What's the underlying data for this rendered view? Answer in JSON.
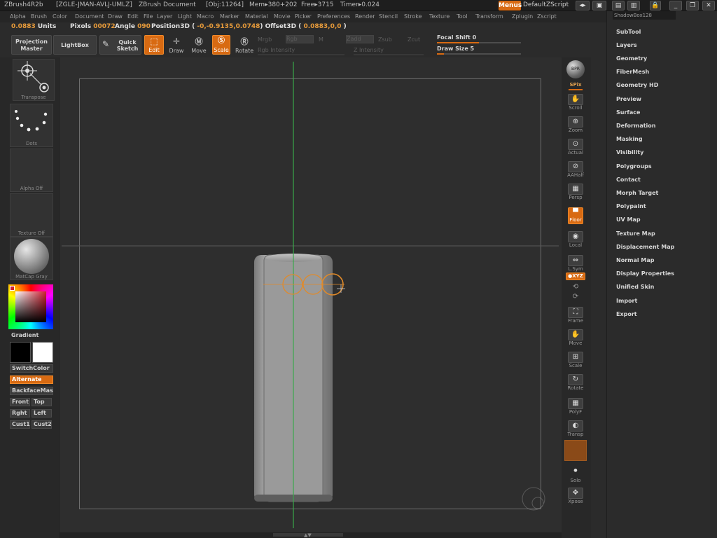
{
  "title": {
    "app": "ZBrush4R2b",
    "license": "[ZGLE-JMAN-AVLJ-UMLZ]",
    "document": "ZBrush Document",
    "obj": "[Obj:11264]",
    "mem": "Mem▸380+202",
    "free": "Free▸3715",
    "timer": "Timer▸0.024",
    "menus_button": "Menus",
    "script": "DefaultZScript",
    "shadowbox": "ShadowBox128"
  },
  "menu_items": [
    "Alpha",
    "Brush",
    "Color",
    "Document",
    "Draw",
    "Edit",
    "File",
    "Layer",
    "Light",
    "Macro",
    "Marker",
    "Material",
    "Movie",
    "Picker",
    "Preferences",
    "Render",
    "Stencil",
    "Stroke",
    "Texture",
    "Tool",
    "Transform",
    "Zplugin",
    "Zscript"
  ],
  "info": {
    "units_value": "0.0883",
    "units_label": "Units",
    "pixols_label": "Pixols",
    "pixols_value": "00072",
    "angle_label": "Angle",
    "angle_value": "090",
    "position_label": "Position3D (",
    "position_value": "-0,-0.9135,0.0748",
    "offset_label": ")  Offset3D (",
    "offset_value": "0.0883,0,0",
    "close_paren": ")"
  },
  "toolbar": {
    "projection_master": "Projection Master",
    "lightbox": "LightBox",
    "quick_sketch": "Quick Sketch",
    "edit": "Edit",
    "draw": "Draw",
    "move": "Move",
    "scale": "Scale",
    "rotate": "Rotate",
    "mrgb": "Mrgb",
    "rgb": "Rgb",
    "m": "M",
    "zadd": "Zadd",
    "zsub": "Zsub",
    "zcut": "Zcut",
    "rgb_intensity": "Rgb Intensity",
    "z_intensity": "Z Intensity",
    "focal_shift_label": "Focal Shift",
    "focal_shift_value": "0",
    "draw_size_label": "Draw Size",
    "draw_size_value": "5",
    "focal_shift_level": 0.5,
    "draw_size_level": 0.08
  },
  "left_shelf": {
    "transpose": "Transpose",
    "dots": "Dots",
    "alpha_off": "Alpha Off",
    "texture_off": "Texture Off",
    "matcap": "MatCap Gray",
    "gradient": "Gradient",
    "switch_color": "SwitchColor",
    "alternate": "Alternate",
    "backface": "BackfaceMas",
    "front": "Front",
    "top": "Top",
    "right": "Rght",
    "left": "Left",
    "cust1": "Cust1",
    "cust2": "Cust2"
  },
  "right_shelf": {
    "bpr": "BPR",
    "spix": "SPix",
    "scroll": "Scroll",
    "zoom": "Zoom",
    "actual": "Actual",
    "aahalf": "AAHalf",
    "persp": "Persp",
    "floor": "Floor",
    "local": "Local",
    "lsym": "L.Sym",
    "xyz": "●XYZ",
    "frame": "Frame",
    "move": "Move",
    "scale": "Scale",
    "rotate": "Rotate",
    "polyf": "PolyF",
    "transp": "Transp",
    "solo": "Solo",
    "xpose": "Xpose"
  },
  "tray_items": [
    "SubTool",
    "Layers",
    "Geometry",
    "FiberMesh",
    "Geometry HD",
    "Preview",
    "Surface",
    "Deformation",
    "Masking",
    "Visibility",
    "Polygroups",
    "Contact",
    "Morph Target",
    "Polypaint",
    "UV Map",
    "Texture Map",
    "Displacement Map",
    "Normal Map",
    "Display Properties",
    "Unified Skin",
    "Import",
    "Export"
  ],
  "colors": {
    "accent": "#d86a12",
    "value_text": "#e69a3a",
    "background": "#2b2b2b",
    "axis_green": "#3aa84a",
    "brush_ring": "#e08a2a"
  }
}
